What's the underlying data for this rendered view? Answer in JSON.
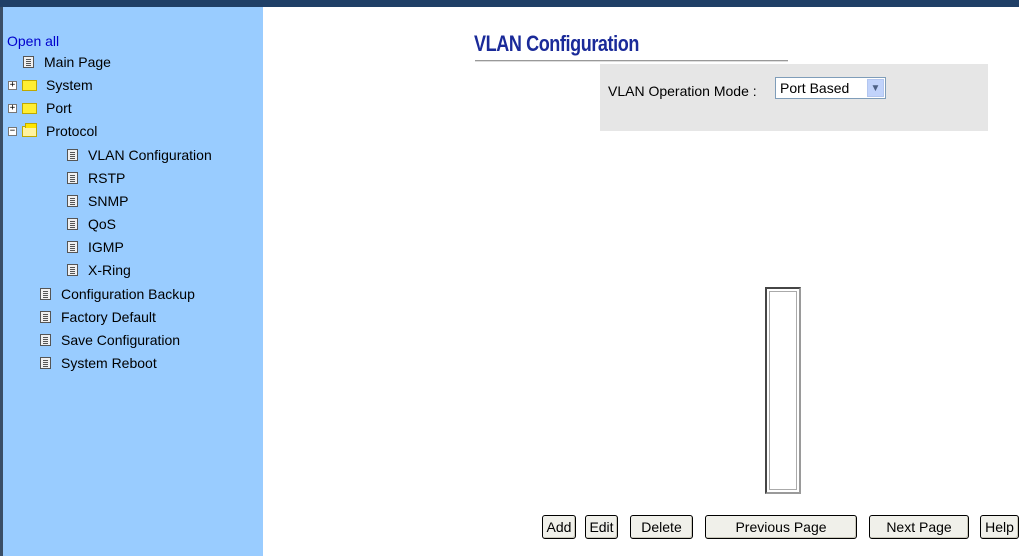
{
  "sidebar": {
    "open_all": "Open all",
    "items": [
      {
        "label": "Main Page"
      },
      {
        "label": "System"
      },
      {
        "label": "Port"
      },
      {
        "label": "Protocol"
      },
      {
        "label": "VLAN Configuration"
      },
      {
        "label": "RSTP"
      },
      {
        "label": "SNMP"
      },
      {
        "label": "QoS"
      },
      {
        "label": "IGMP"
      },
      {
        "label": "X-Ring"
      },
      {
        "label": "Configuration Backup"
      },
      {
        "label": "Factory Default"
      },
      {
        "label": "Save Configuration"
      },
      {
        "label": "System Reboot"
      }
    ]
  },
  "main": {
    "title": "VLAN Configuration",
    "mode_label": "VLAN Operation Mode :",
    "mode_value": "Port Based",
    "buttons": {
      "add": "Add",
      "edit": "Edit",
      "delete": "Delete",
      "previous": "Previous Page",
      "next": "Next Page",
      "help": "Help"
    }
  },
  "colors": {
    "sidebar_bg": "#99ccff",
    "title": "#1a2a99",
    "link": "#0000cc"
  }
}
